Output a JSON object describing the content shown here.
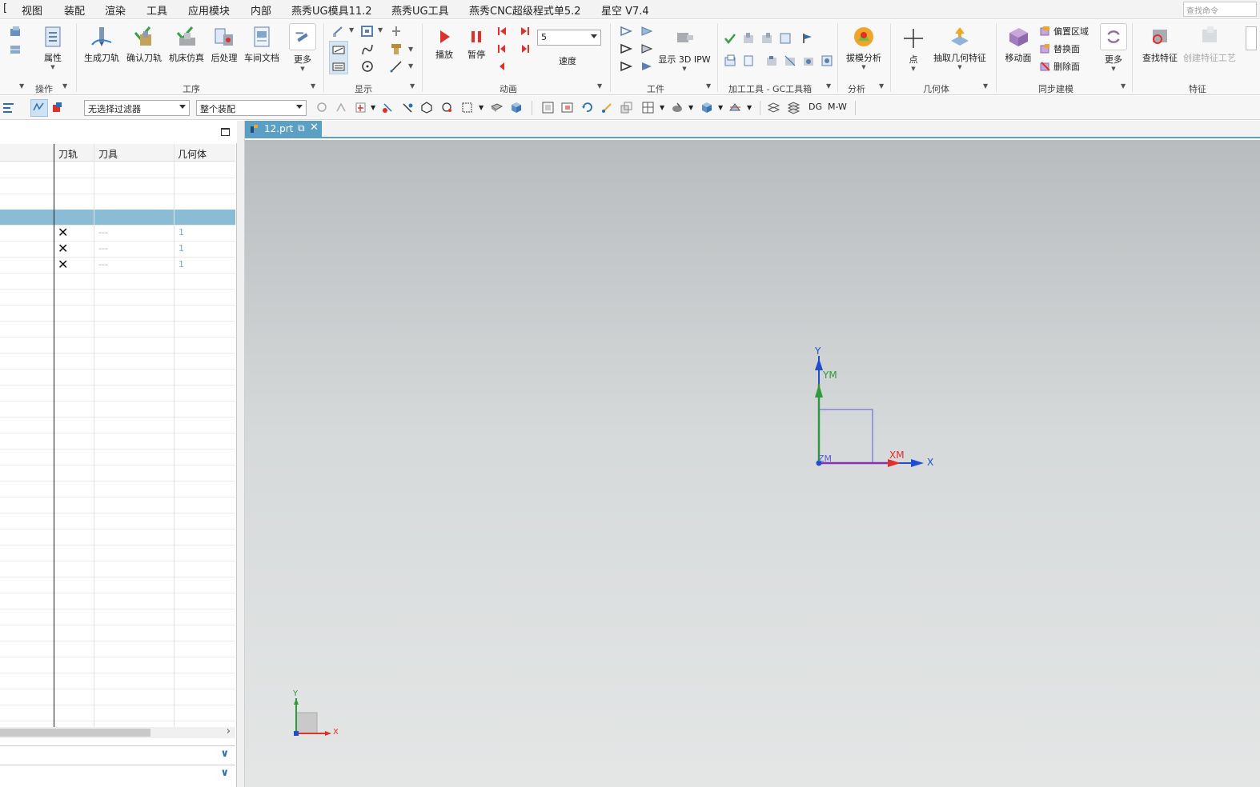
{
  "menubar": {
    "items": [
      "视图",
      "装配",
      "渲染",
      "工具",
      "应用模块",
      "内部",
      "燕秀UG模具11.2",
      "燕秀UG工具",
      "燕秀CNC超级程式单5.2",
      "星空 V7.4"
    ],
    "search_placeholder": "查找命令"
  },
  "ribbon": {
    "groups": {
      "operation": "操作",
      "process": "工序",
      "display": "显示",
      "animation": "动画",
      "workpiece": "工件",
      "gc_toolbox": "加工工具 - GC工具箱",
      "analysis": "分析",
      "geometry": "几何体",
      "sync_modeling": "同步建模",
      "feature": "特征"
    },
    "buttons": {
      "attributes": "属性",
      "generate_toolpath": "生成刀轨",
      "verify_toolpath": "确认刀轨",
      "machine_sim": "机床仿真",
      "postprocess": "后处理",
      "shop_doc": "车间文档",
      "more1": "更多",
      "play": "播放",
      "pause": "暂停",
      "speed_value": "5",
      "speed": "速度",
      "show_3d_ipw": "显示 3D IPW",
      "draft_analysis": "拔模分析",
      "point": "点",
      "extract_geometry": "抽取几何特征",
      "move_face": "移动面",
      "offset_region": "偏置区域",
      "replace_face": "替换面",
      "delete_face": "删除面",
      "more2": "更多",
      "find_feature": "查找特征",
      "create_feature_process": "创建特征工艺"
    },
    "colors": {
      "play": "#e0302a",
      "accent": "#5c9fc4"
    }
  },
  "toolbar2": {
    "filter": "无选择过滤器",
    "scope": "整个装配",
    "dg": "DG",
    "mw": "M-W"
  },
  "navigator": {
    "columns": [
      "刀轨",
      "刀具",
      "几何体"
    ],
    "rows": [
      {
        "path": "✕",
        "tool": "---",
        "geom": "1"
      },
      {
        "path": "✕",
        "tool": "---",
        "geom": "1"
      },
      {
        "path": "✕",
        "tool": "---",
        "geom": "1"
      }
    ]
  },
  "tab": {
    "label": "12.prt"
  },
  "viewport": {
    "wcs": {
      "y": "Y",
      "ym": "YM",
      "zm": "ZM",
      "xm": "XM",
      "x": "X"
    },
    "mini": {
      "y": "Y",
      "x": "X"
    }
  }
}
